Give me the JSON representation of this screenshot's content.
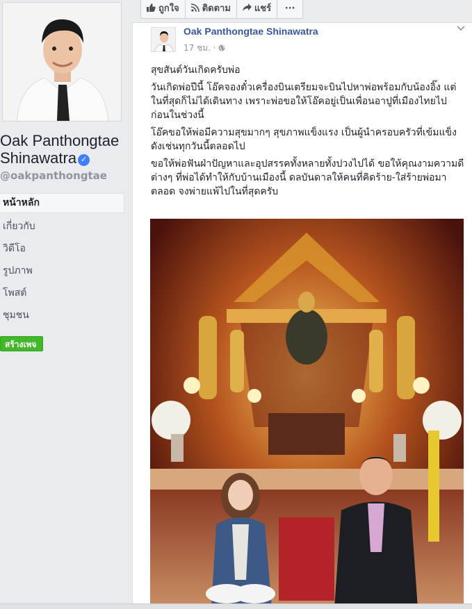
{
  "profile": {
    "name_line1": "Oak Panthongtae",
    "name_line2": "Shinawatra",
    "verified_glyph": "✓",
    "handle": "@oakpanthongtae"
  },
  "nav": {
    "items": [
      {
        "label": "หน้าหลัก",
        "active": true
      },
      {
        "label": "เกี่ยวกับ"
      },
      {
        "label": "วิดีโอ"
      },
      {
        "label": "รูปภาพ"
      },
      {
        "label": "โพสต์"
      },
      {
        "label": "ชุมชน"
      }
    ],
    "create_page": "สร้างเพจ"
  },
  "actions": {
    "like": "ถูกใจ",
    "follow": "ติดตาม",
    "share": "แชร์",
    "more": "···",
    "like_icon": "thumbs-up-icon",
    "follow_icon": "rss-icon",
    "share_icon": "share-arrow-icon"
  },
  "post": {
    "author": "Oak Panthongtae Shinawatra",
    "time": "17 ชม. · ",
    "paragraphs": [
      "สุขสันต์วันเกิดครับพ่อ",
      "วันเกิดพ่อปีนี้ โอ๊คจองตั๋วเครื่องบินเตรียมจะบินไปหาพ่อพร้อมกับน้องอิ๊ง แต่ในที่สุดก็ไม่ได้เดินทาง เพราะพ่อขอให้โอ๊คอยู่เป็นเพื่อนอาปูที่เมืองไทยไปก่อนในช่วงนี้",
      "โอ๊คขอให้พ่อมีความสุขมากๆ สุขภาพแข็งแรง เป็นผู้นำครอบครัวที่เข้มแข็ง ดังเช่นทุกวันนี้ตลอดไป",
      "ขอให้พ่อฟันฝ่าปัญหาและอุปสรรคทั้งหลายทั้งปวงไปได้ ขอให้คุณงามความดีต่างๆ ที่พ่อได้ทำให้กับบ้านเมืองนี้ ดลบันดาลให้คนที่คิดร้าย-ใส่ร้ายพ่อมาตลอด จงพ่ายแพ้ไปในที่สุดครับ"
    ]
  },
  "colors": {
    "link": "#365899",
    "create_button": "#42b72a",
    "verified": "#4080ff"
  }
}
